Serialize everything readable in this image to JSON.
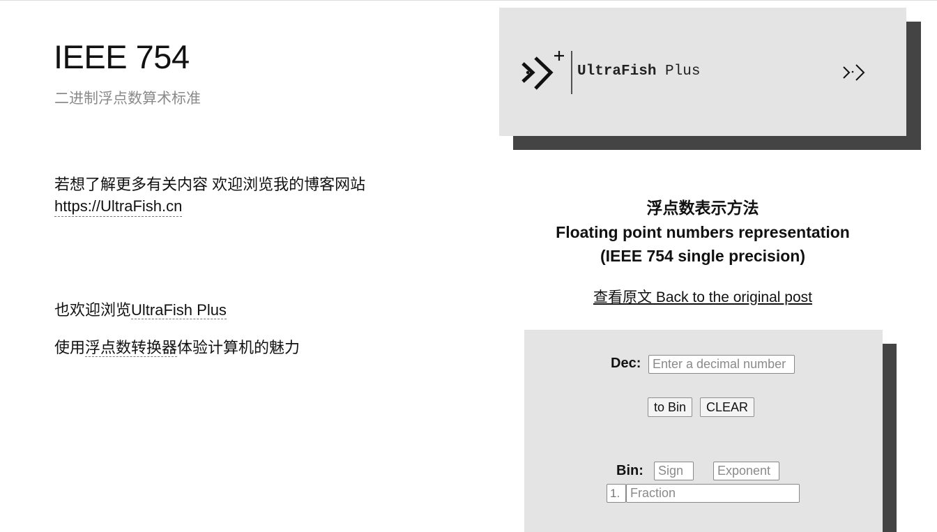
{
  "left": {
    "title": "IEEE 754",
    "subtitle": "二进制浮点数算术标准",
    "blog_text": "若想了解更多有关内容 欢迎浏览我的博客网站",
    "blog_link": "https://UltraFish.cn",
    "plus_prefix": "也欢迎浏览",
    "plus_link": "UltraFish Plus",
    "conv_prefix": "使用",
    "conv_link": "浮点数转换器",
    "conv_suffix": "体验计算机的魅力"
  },
  "logo": {
    "brand_bold": "UltraFish",
    "brand_plain": " Plus",
    "icon": "ultrafish-logo-icon",
    "nav_icon": "double-chevron-right-icon"
  },
  "representation": {
    "line1": "浮点数表示方法",
    "line2": "Floating point numbers representation",
    "line3": "(IEEE 754 single precision)",
    "link": "查看原文 Back to the original post"
  },
  "converter": {
    "dec_label": "Dec:",
    "dec_placeholder": "Enter a decimal number",
    "to_bin_label": "to Bin",
    "clear_label": "CLEAR",
    "bin_label": "Bin:",
    "sign_placeholder": "Sign",
    "exponent_placeholder": "Exponent",
    "fraction_prefix": "1.",
    "fraction_placeholder": "Fraction"
  },
  "colors": {
    "card_bg": "#e4e4e4",
    "card_shadow": "#444444",
    "muted_text": "#8a8a8a"
  }
}
